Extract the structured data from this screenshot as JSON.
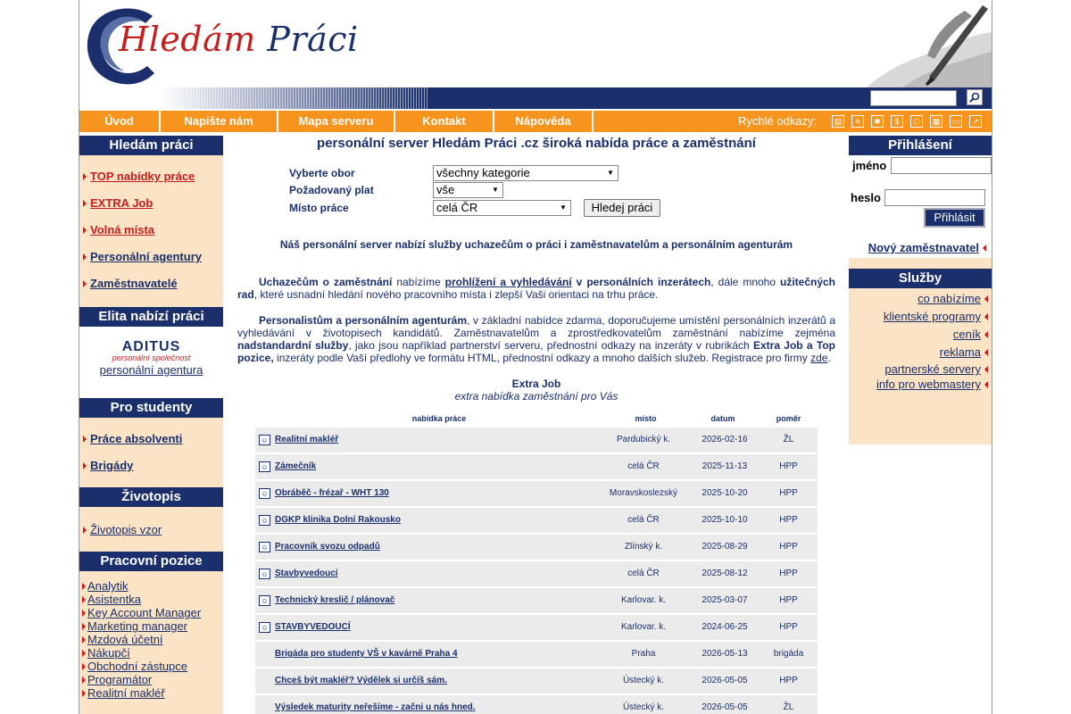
{
  "logo": {
    "part1": "Hledám",
    "part2": "Práci"
  },
  "menu": {
    "items": [
      "Úvod",
      "Napište nám",
      "Mapa serveru",
      "Kontakt",
      "Nápověda"
    ],
    "quick_label": "Rychlé odkazy:"
  },
  "left": {
    "h1": "Hledám práci",
    "links1": [
      "TOP nabídky práce",
      "EXTRA Job",
      "Volná místa",
      "Personální agentury",
      "Zaměstnavatelé"
    ],
    "h2": "Elita nabízí práci",
    "aditus": "ADITUS",
    "aditus_sub": "personální společnost",
    "aditus_link": "personální agentura",
    "h3": "Pro studenty",
    "links3": [
      "Práce absolventi",
      "Brigády"
    ],
    "h4": "Životopis",
    "links4": [
      "Životopis vzor"
    ],
    "h5": "Pracovní pozice",
    "links5": [
      "Analytik",
      "Asistentka",
      "Key Account Manager",
      "Marketing manager",
      "Mzdová účetní",
      "Nákupčí",
      "Obchodní zástupce",
      "Programátor",
      "Realitní makléř"
    ]
  },
  "center": {
    "title": "personální server Hledám Práci .cz široká nabída práce a zaměstnání",
    "f1_label": "Vyberte obor",
    "f1_value": "všechny kategorie",
    "f2_label": "Požadovaný plat",
    "f2_value": "vše",
    "f3_label": "Místo práce",
    "f3_value": "celá ČR",
    "find": "Hledej práci",
    "intro": "Náš personální server nabízí služby uchazečům o práci i zaměstnavatelům a personálním agenturám",
    "p1": {
      "a": "Uchazečům o zaměstnání",
      "b": " nabízíme ",
      "c": "prohlížení a vyhledávání",
      "d": " v personálních inzerátech",
      "e": ", dále mnoho ",
      "f": "užitečných rad",
      "g": ", které usnadní hledání nového pracovního místa i zlepší Vaši orientaci na trhu práce."
    },
    "p2": {
      "a": "Personalistům a personálním agenturám",
      "b": ", v základní nabídce zdarma, doporučujeme umístění personálních inzerátů a vyhledávání v životopisech kandidátů. Zaměstnavatelům a zprostředkovatelům zaměstnání nabízíme zejména ",
      "c": "nadstandardní služby",
      "d": ", jako jsou například partnerství serveru, přednostní odkazy na inzeráty v rubrikách ",
      "e": "Extra Job a Top pozice,",
      "f": " inzeráty podle Vaší předlohy ve formátu HTML, přednostní odkazy a mnoho dalších služeb. Registrace pro firmy ",
      "g": "zde",
      "h": "."
    },
    "ej_title": "Extra Job",
    "ej_sub": "extra nabídka zaměstnání pro Vás",
    "cols": [
      "nabídka práce",
      "místo",
      "datum",
      "poměr"
    ],
    "jobs": [
      {
        "t": "Realitní makléř",
        "m": "Pardubický k.",
        "d": "2026-02-16",
        "p": "ŽL",
        "icon": true
      },
      {
        "t": "Zámečník",
        "m": "celá ČR",
        "d": "2025-11-13",
        "p": "HPP",
        "icon": true
      },
      {
        "t": "Obráběč - frézař - WHT 130",
        "m": "Moravskoslezský",
        "d": "2025-10-20",
        "p": "HPP",
        "icon": true
      },
      {
        "t": "DGKP klinika Dolní Rakousko",
        "m": "celá ČR",
        "d": "2025-10-10",
        "p": "HPP",
        "icon": true
      },
      {
        "t": "Pracovník svozu odpadů",
        "m": "Zlínský k.",
        "d": "2025-08-29",
        "p": "HPP",
        "icon": true
      },
      {
        "t": "Stavbyvedoucí",
        "m": "celá ČR",
        "d": "2025-08-12",
        "p": "HPP",
        "icon": true
      },
      {
        "t": "Technický kreslič / plánovač",
        "m": "Karlovar. k.",
        "d": "2025-03-07",
        "p": "HPP",
        "icon": true
      },
      {
        "t": "STAVBYVEDOUCÍ",
        "m": "Karlovar. k.",
        "d": "2024-06-25",
        "p": "HPP",
        "icon": true
      },
      {
        "t": "Brigáda pro studenty VŠ v kavárně Praha 4",
        "m": "Praha",
        "d": "2026-05-13",
        "p": "brigáda",
        "icon": false
      },
      {
        "t": "Chceš být makléř? Výdělek si určíš sám.",
        "m": "Ústecký k.",
        "d": "2026-05-05",
        "p": "HPP",
        "icon": false
      },
      {
        "t": "Výsledek maturity neřešíme - začni u nás hned.",
        "m": "Ústecký k.",
        "d": "2026-05-05",
        "p": "ŽL",
        "icon": false
      }
    ]
  },
  "right": {
    "h1": "Přihlášení",
    "name_label": "jméno",
    "pass_label": "heslo",
    "login_btn": "Přihlásit",
    "new_employer": "Nový zaměstnavatel",
    "h2": "Služby",
    "links": [
      "co nabízíme",
      "klientské programy",
      "ceník",
      "reklama",
      "partnerské servery",
      "info pro webmastery"
    ]
  },
  "colors": {
    "navy": "#1a2f6b",
    "orange": "#f7941d",
    "peach": "#fbe3c6",
    "red": "#c41e1e"
  }
}
